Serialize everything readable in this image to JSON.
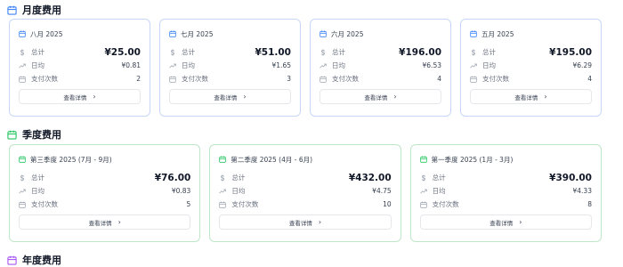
{
  "sections": {
    "monthly": {
      "title": "月度费用",
      "color": "#3b82f6"
    },
    "quarterly": {
      "title": "季度费用",
      "color": "#22c55e"
    },
    "yearly": {
      "title": "年度费用",
      "color": "#a855f7"
    }
  },
  "labels": {
    "total": "总计",
    "daily_avg": "日均",
    "payment_count": "支付次数",
    "view_details": "查看详情"
  },
  "monthly": [
    {
      "title": "八月 2025",
      "total": "¥25.00",
      "daily_avg": "¥0.81",
      "count": "2"
    },
    {
      "title": "七月 2025",
      "total": "¥51.00",
      "daily_avg": "¥1.65",
      "count": "3"
    },
    {
      "title": "六月 2025",
      "total": "¥196.00",
      "daily_avg": "¥6.53",
      "count": "4"
    },
    {
      "title": "五月 2025",
      "total": "¥195.00",
      "daily_avg": "¥6.29",
      "count": "4"
    }
  ],
  "quarterly": [
    {
      "title": "第三季度 2025 (7月 - 9月)",
      "total": "¥76.00",
      "daily_avg": "¥0.83",
      "count": "5"
    },
    {
      "title": "第二季度 2025 (4月 - 6月)",
      "total": "¥432.00",
      "daily_avg": "¥4.75",
      "count": "10"
    },
    {
      "title": "第一季度 2025 (1月 - 3月)",
      "total": "¥390.00",
      "daily_avg": "¥4.33",
      "count": "8"
    }
  ]
}
